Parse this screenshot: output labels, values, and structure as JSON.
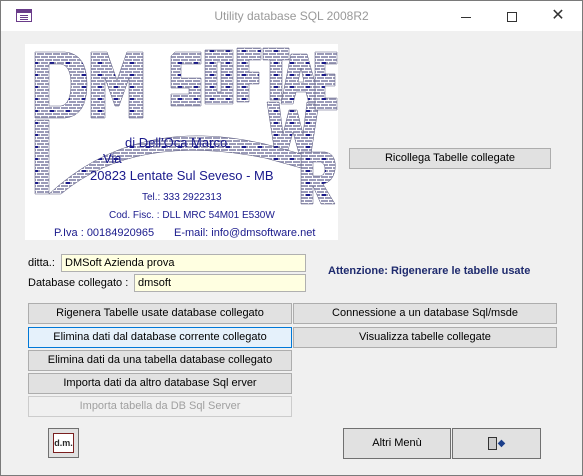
{
  "window": {
    "title": "Utility database SQL 2008R2",
    "close_glyph": "✕"
  },
  "logo": {
    "company": "DM SOFTWARE",
    "author": "di Dell'Oca Marco",
    "via": "Via",
    "address": "20823  Lentate Sul Seveso - MB",
    "tel": "Tel.: 333 2922313",
    "cod_fisc": "Cod. Fisc. : DLL MRC 54M01 E530W",
    "piva": "P.Iva : 00184920965",
    "email": "E-mail: info@dmsoftware.net",
    "brick_color": "#1a1a8c"
  },
  "buttons": {
    "ricollega": "Ricollega Tabelle collegate",
    "rigenera": "Rigenera Tabelle usate database collegato",
    "elimina_corrente": "Elimina dati dal database corrente collegato",
    "elimina_tabella": "Elimina dati da una tabella database collegato",
    "importa_dati": "Importa dati da altro database Sql erver",
    "importa_tabella": "Importa tabella da DB Sql Server",
    "connessione": "Connessione a un database Sql/msde",
    "visualizza": "Visualizza tabelle collegate",
    "altri_menu": "Altri Menù",
    "dm_icon_label": "d.m.",
    "exit_icon": "exit-door-icon"
  },
  "form": {
    "ditta_label": "ditta.:",
    "ditta_value": "DMSoft Azienda prova",
    "db_label": "Database collegato :",
    "db_value": "dmsoft"
  },
  "warning": "Attenzione: Rigenerare le tabelle usate",
  "colors": {
    "warning_text": "#1f2b6e",
    "field_background": "#ffffe1",
    "focus_border": "#0078d7"
  }
}
